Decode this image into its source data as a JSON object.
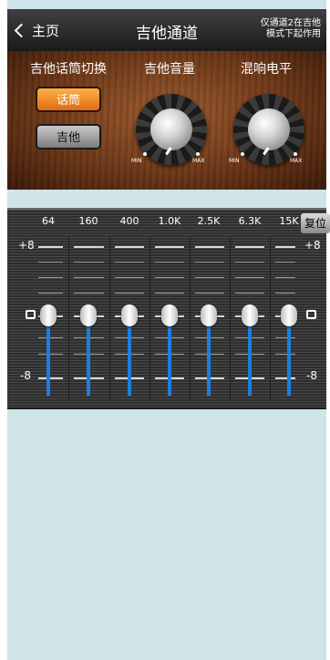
{
  "header": {
    "back_label": "主页",
    "title": "吉他通道",
    "hint_line1": "仅通道2在吉他",
    "hint_line2": "模式下起作用"
  },
  "controls": {
    "switch_label": "吉他话筒切换",
    "mic_button": "话筒",
    "guitar_button": "吉他",
    "selected": "话筒",
    "volume_label": "吉他音量",
    "reverb_label": "混响电平",
    "min_label": "MIN",
    "max_label": "MAX"
  },
  "eq": {
    "bands": [
      "64",
      "160",
      "400",
      "1.0K",
      "2.5K",
      "6.3K",
      "15K"
    ],
    "values": [
      0,
      0,
      0,
      0,
      0,
      0,
      0
    ],
    "reset_label": "复位",
    "scale_top": "+8",
    "scale_zero": "0",
    "scale_bottom": "-8",
    "accent_color": "#1a7fe0"
  }
}
